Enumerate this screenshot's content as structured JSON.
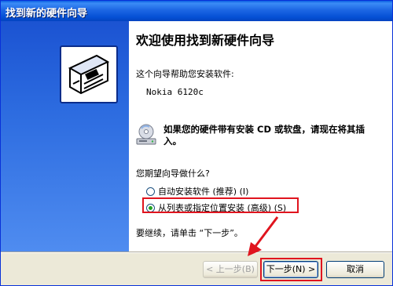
{
  "window": {
    "title": "找到新的硬件向导"
  },
  "content": {
    "heading": "欢迎使用找到新硬件向导",
    "intro": "这个向导帮助您安装软件:",
    "device_name": "Nokia 6120c",
    "cd_prompt": "如果您的硬件带有安装 CD 或软盘，请现在将其插入。",
    "question": "您期望向导做什么?",
    "options": [
      {
        "label": "自动安装软件 (推荐) (I)",
        "selected": false
      },
      {
        "label": "从列表或指定位置安装 (高级) (S)",
        "selected": true
      }
    ],
    "continue_text": "要继续，请单击 “下一步”。"
  },
  "buttons": {
    "back": "< 上一步(B)",
    "next": "下一步(N) >",
    "cancel": "取消"
  },
  "icons": {
    "wizard_icon": "hardware-card-icon",
    "cd_icon": "cd-drive-icon",
    "annotation": "red-arrow"
  },
  "colors": {
    "titlebar": "#0a5fe2",
    "left_panel": "#1b53d2",
    "highlight": "#e0141e"
  }
}
